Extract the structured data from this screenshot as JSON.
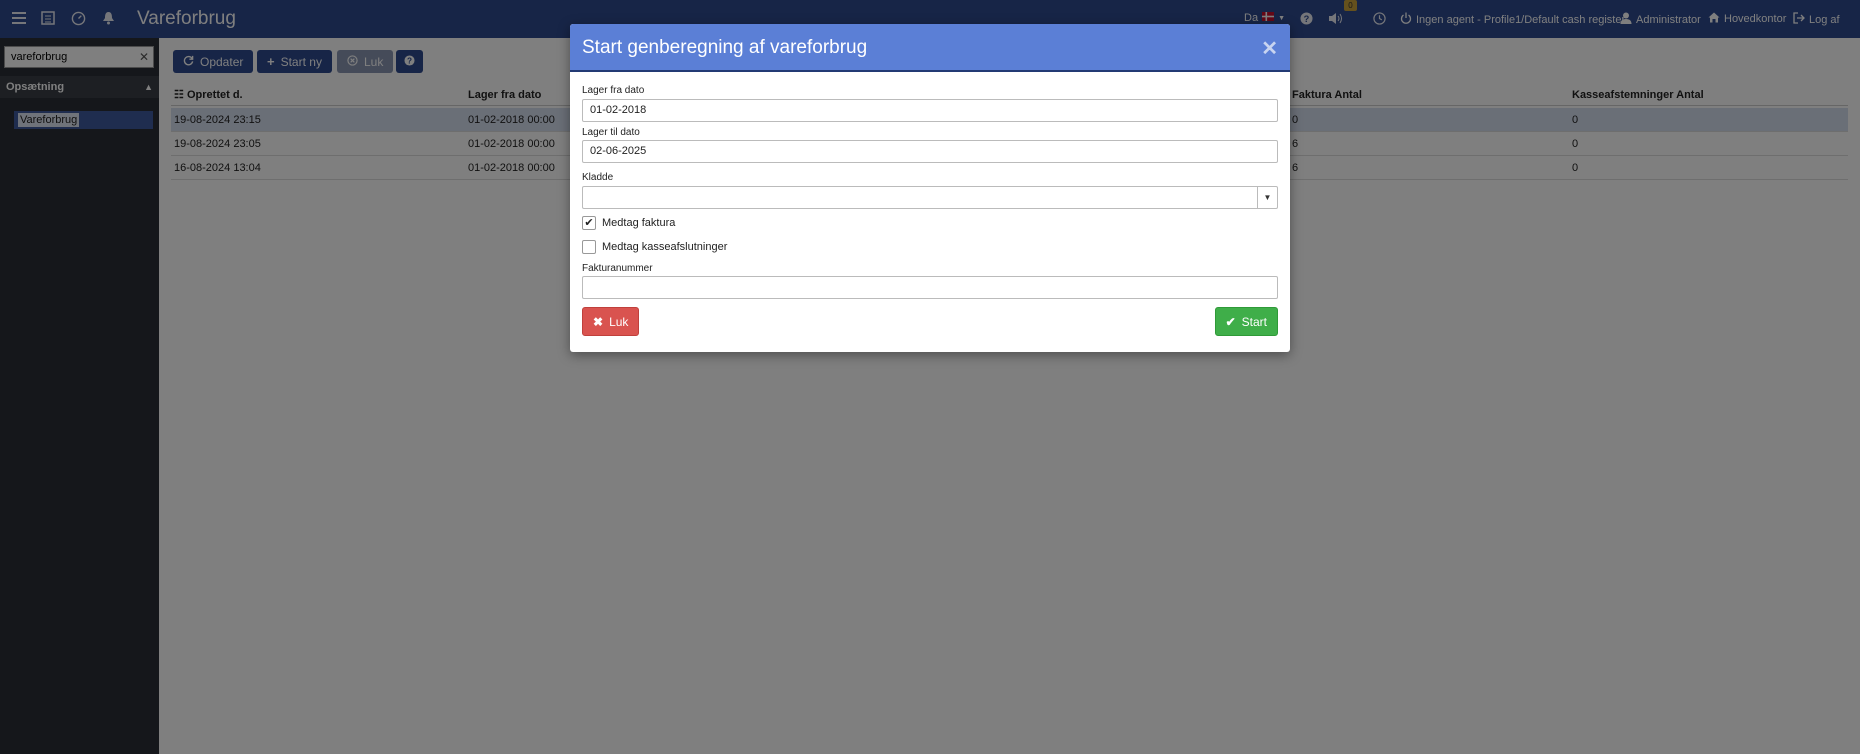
{
  "app": {
    "title": "Vareforbrug"
  },
  "topbar": {
    "language": "Da",
    "notification_count": "0",
    "agent": "Ingen agent - Profile1/Default cash register",
    "user": "Administrator",
    "office": "Hovedkontor",
    "logout": "Log af"
  },
  "sidebar": {
    "search_value": "vareforbrug",
    "section": "Opsætning",
    "item": "Vareforbrug"
  },
  "toolbar": {
    "refresh": "Opdater",
    "start_new": "Start ny",
    "close": "Luk"
  },
  "grid": {
    "columns": [
      "Oprettet d.",
      "Lager fra dato",
      "Faktura Antal",
      "Kasseafstemninger Antal"
    ],
    "rows": [
      {
        "created": "19-08-2024 23:15",
        "from": "01-02-2018 00:00",
        "invoices": "0",
        "cash": "0"
      },
      {
        "created": "19-08-2024 23:05",
        "from": "01-02-2018 00:00",
        "invoices": "6",
        "cash": "0"
      },
      {
        "created": "16-08-2024 13:04",
        "from": "01-02-2018 00:00",
        "invoices": "6",
        "cash": "0"
      }
    ]
  },
  "modal": {
    "title": "Start genberegning af vareforbrug",
    "from_label": "Lager fra dato",
    "from_value": "01-02-2018",
    "to_label": "Lager til dato",
    "to_value": "02-06-2025",
    "draft_label": "Kladde",
    "draft_value": "",
    "include_invoice_label": "Medtag faktura",
    "include_invoice_checked": true,
    "include_cash_label": "Medtag kasseafslutninger",
    "include_cash_checked": false,
    "invoice_no_label": "Fakturanummer",
    "invoice_no_value": "",
    "close_label": "Luk",
    "start_label": "Start"
  },
  "colors": {
    "topbar": "#2e4a8f",
    "modal_header": "#5b7fd6",
    "danger": "#d9534f",
    "success": "#3fae49"
  }
}
